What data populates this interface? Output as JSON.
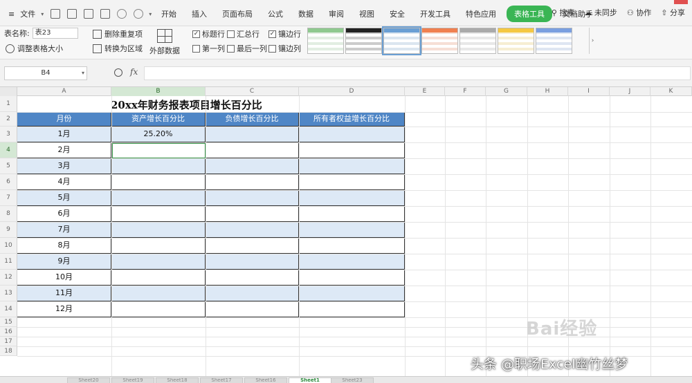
{
  "menubar": {
    "file_label": "文件",
    "tabs": [
      "开始",
      "插入",
      "页面布局",
      "公式",
      "数据",
      "审阅",
      "视图",
      "安全",
      "开发工具",
      "特色应用",
      "表格工具",
      "文档助手"
    ],
    "active_tab_index": 10,
    "search_label": "搜索",
    "unsync_label": "未同步",
    "collab_label": "协作",
    "share_label": "分享"
  },
  "ribbon": {
    "table_name_label": "表名称:",
    "table_name_value": "表23",
    "resize_label": "调整表格大小",
    "dedupe_label": "删除重复项",
    "to_range_label": "转换为区域",
    "outer_label": "外部数据",
    "checks": [
      {
        "label": "标题行",
        "checked": true
      },
      {
        "label": "汇总行",
        "checked": false
      },
      {
        "label": "镶边行",
        "checked": true
      },
      {
        "label": "第一列",
        "checked": false
      },
      {
        "label": "最后一列",
        "checked": false
      },
      {
        "label": "镶边列",
        "checked": false
      }
    ],
    "style_colors": [
      "#8fc98f",
      "#222222",
      "#6a9fd4",
      "#f08050",
      "#aaaaaa",
      "#f5c842",
      "#7a9fe0"
    ],
    "selected_style_index": 2
  },
  "formula": {
    "name_box": "B4",
    "fx_label": "fx",
    "value": ""
  },
  "grid": {
    "columns": [
      "A",
      "B",
      "C",
      "D",
      "E",
      "F",
      "G",
      "H",
      "I",
      "J",
      "K"
    ],
    "rows": [
      "1",
      "2",
      "3",
      "4",
      "5",
      "6",
      "7",
      "8",
      "9",
      "10",
      "11",
      "12",
      "13",
      "14",
      "15",
      "16",
      "17",
      "18"
    ],
    "active_column": "B",
    "active_row": "4"
  },
  "sheet": {
    "title": "20xx年财务报表项目增长百分比",
    "headers": [
      "月份",
      "资产增长百分比",
      "负债增长百分比",
      "所有者权益增长百分比"
    ],
    "rows": [
      [
        "1月",
        "25.20%",
        "",
        ""
      ],
      [
        "2月",
        "",
        "",
        ""
      ],
      [
        "3月",
        "",
        "",
        ""
      ],
      [
        "4月",
        "",
        "",
        ""
      ],
      [
        "5月",
        "",
        "",
        ""
      ],
      [
        "6月",
        "",
        "",
        ""
      ],
      [
        "7月",
        "",
        "",
        ""
      ],
      [
        "8月",
        "",
        "",
        ""
      ],
      [
        "9月",
        "",
        "",
        ""
      ],
      [
        "10月",
        "",
        "",
        ""
      ],
      [
        "11月",
        "",
        "",
        ""
      ],
      [
        "12月",
        "",
        "",
        ""
      ]
    ],
    "colors": {
      "header": "#4f86c6",
      "band": "#dde9f6",
      "selection": "#2e8b3e"
    }
  },
  "sheets": {
    "tabs": [
      "Sheet20",
      "Sheet19",
      "Sheet18",
      "Sheet17",
      "Sheet16",
      "Sheet1",
      "Sheet23"
    ],
    "active_index": 5
  },
  "watermarks": {
    "baidu": "Bai经验",
    "credit": "头条 @职场Excel幽竹丝梦"
  }
}
